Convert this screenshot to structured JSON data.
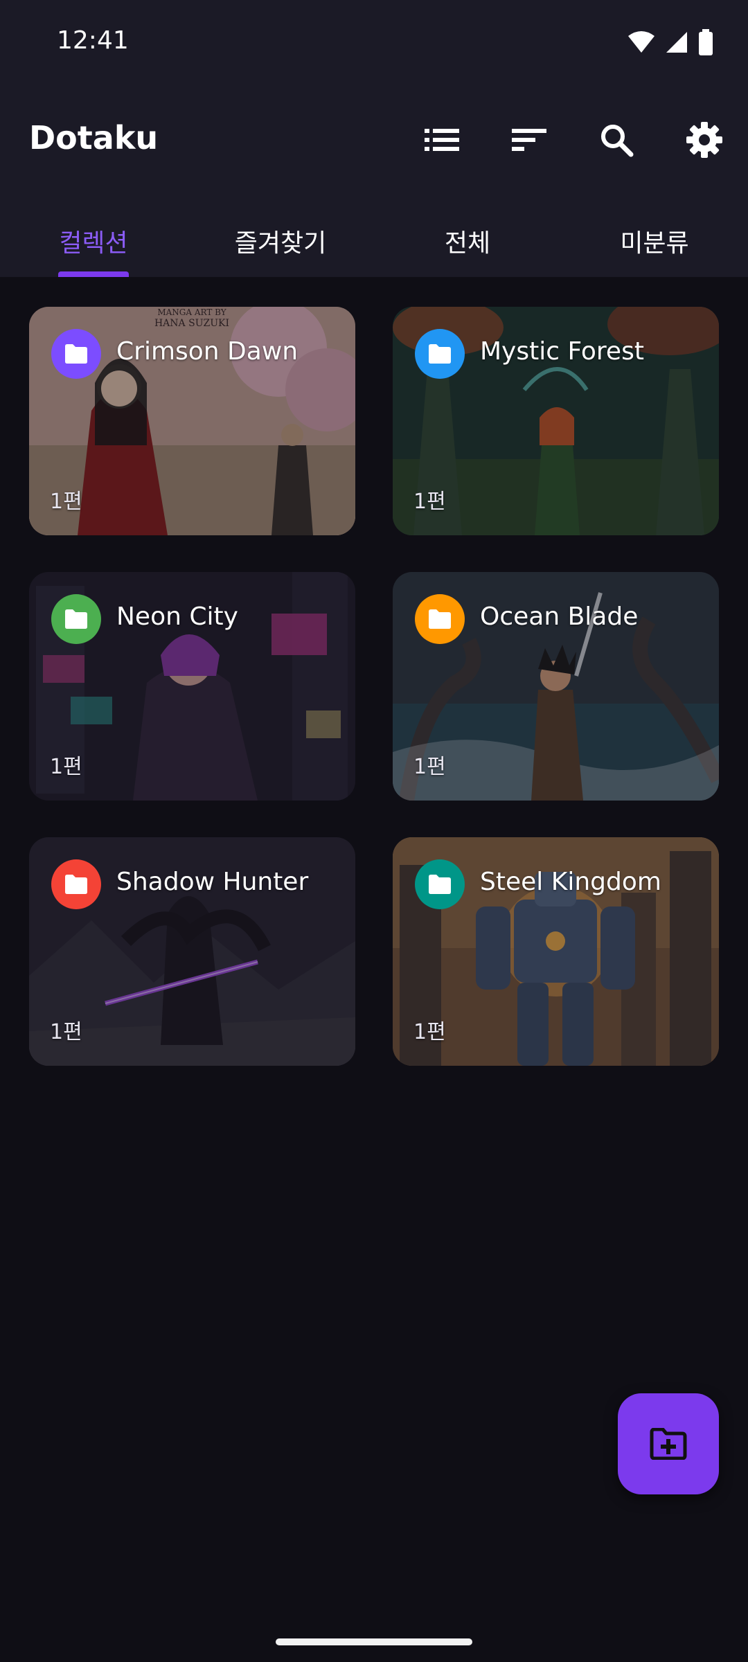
{
  "status_bar": {
    "time": "12:41",
    "icons": [
      "wifi-icon",
      "signal-icon",
      "battery-icon"
    ]
  },
  "app_bar": {
    "title": "Dotaku",
    "actions": [
      "list-view-icon",
      "sort-icon",
      "search-icon",
      "settings-icon"
    ]
  },
  "tabs": [
    {
      "label": "컬렉션",
      "active": true
    },
    {
      "label": "즐겨찾기",
      "active": false
    },
    {
      "label": "전체",
      "active": false
    },
    {
      "label": "미분류",
      "active": false
    }
  ],
  "collections": [
    {
      "name": "Crimson Dawn",
      "count": "1편",
      "folder_color": "#7c4dff",
      "cover_text": "MANGA ART BY HANA SUZUKI"
    },
    {
      "name": "Mystic Forest",
      "count": "1편",
      "folder_color": "#2196f3"
    },
    {
      "name": "Neon City",
      "count": "1편",
      "folder_color": "#4caf50"
    },
    {
      "name": "Ocean Blade",
      "count": "1편",
      "folder_color": "#ff9800"
    },
    {
      "name": "Shadow Hunter",
      "count": "1편",
      "folder_color": "#f44336"
    },
    {
      "name": "Steel Kingdom",
      "count": "1편",
      "folder_color": "#009688"
    }
  ],
  "fab": {
    "icon": "add-folder-icon",
    "color": "#7c3aed"
  },
  "colors": {
    "accent": "#7c3aed",
    "background": "#0f0e15",
    "bar": "#1b1a26"
  }
}
